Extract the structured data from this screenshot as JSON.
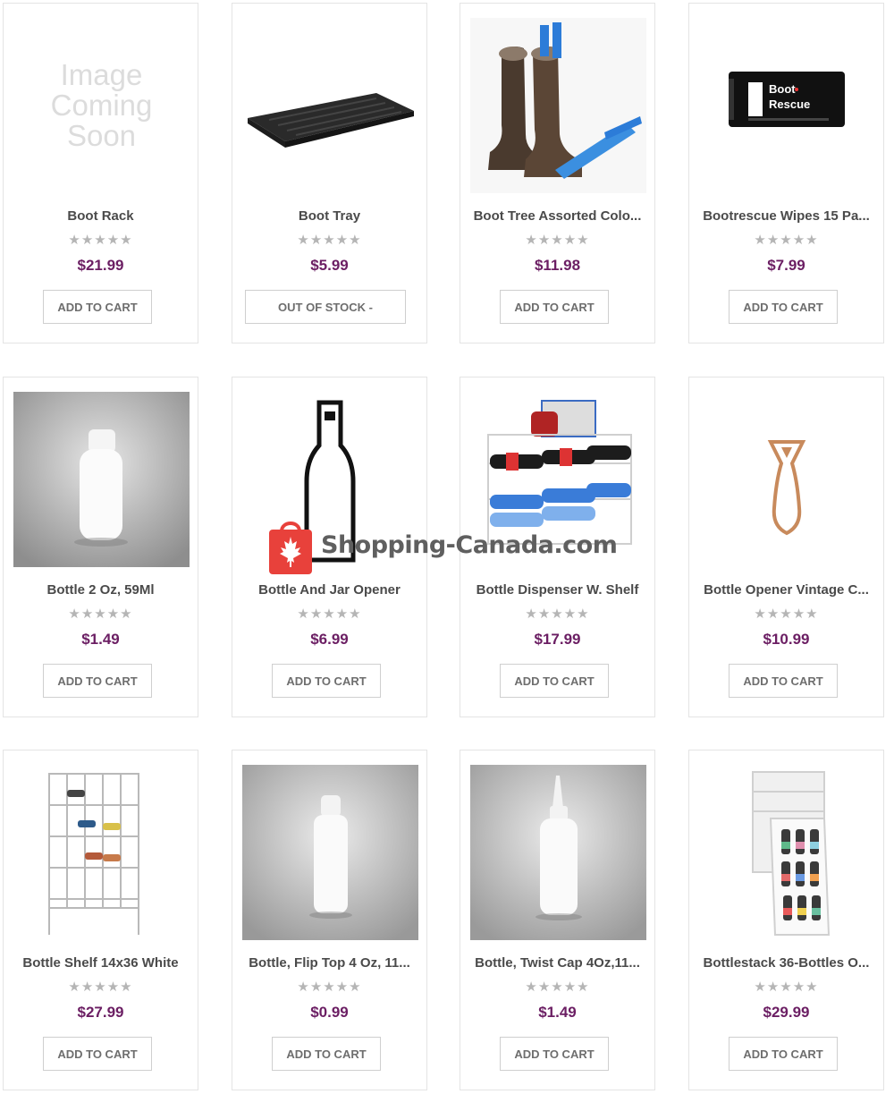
{
  "colors": {
    "price": "#6b1e63",
    "star": "#b5b5b5",
    "border": "#e4e4e4",
    "watermark": "#e8413b"
  },
  "products": [
    {
      "title": "Boot Rack",
      "price": "$21.99",
      "button": "ADD TO CART",
      "image": "image-coming-soon",
      "placeholder": [
        "Image",
        "Coming",
        "Soon"
      ]
    },
    {
      "title": "Boot Tray",
      "price": "$5.99",
      "button": "OUT OF STOCK -",
      "image": "boot-tray"
    },
    {
      "title": "Boot Tree Assorted Colo...",
      "price": "$11.98",
      "button": "ADD TO CART",
      "image": "boots-with-shaper"
    },
    {
      "title": "Bootrescue Wipes 15 Pa...",
      "price": "$7.99",
      "button": "ADD TO CART",
      "image": "wipes-pack",
      "image_text": [
        "Boot",
        "Rescue"
      ]
    },
    {
      "title": "Bottle 2 Oz, 59Ml",
      "price": "$1.49",
      "button": "ADD TO CART",
      "image": "white-bottle"
    },
    {
      "title": "Bottle And Jar Opener",
      "price": "$6.99",
      "button": "ADD TO CART",
      "image": "bottle-outline-opener"
    },
    {
      "title": "Bottle Dispenser W. Shelf",
      "price": "$17.99",
      "button": "ADD TO CART",
      "image": "wire-dispenser"
    },
    {
      "title": "Bottle Opener Vintage C...",
      "price": "$10.99",
      "button": "ADD TO CART",
      "image": "copper-opener"
    },
    {
      "title": "Bottle Shelf 14x36 White",
      "price": "$27.99",
      "button": "ADD TO CART",
      "image": "wire-wine-shelf"
    },
    {
      "title": "Bottle, Flip Top 4 Oz, 11...",
      "price": "$0.99",
      "button": "ADD TO CART",
      "image": "flip-top-bottle"
    },
    {
      "title": "Bottle, Twist Cap 4Oz,11...",
      "price": "$1.49",
      "button": "ADD TO CART",
      "image": "twist-cap-bottle"
    },
    {
      "title": "Bottlestack 36-Bottles O...",
      "price": "$29.99",
      "button": "ADD TO CART",
      "image": "bottlestack-organizer"
    }
  ],
  "rating_stars": "★★★★★",
  "watermark": {
    "text": "Shopping-Canada.com",
    "icon": "maple-leaf-bag-icon"
  }
}
